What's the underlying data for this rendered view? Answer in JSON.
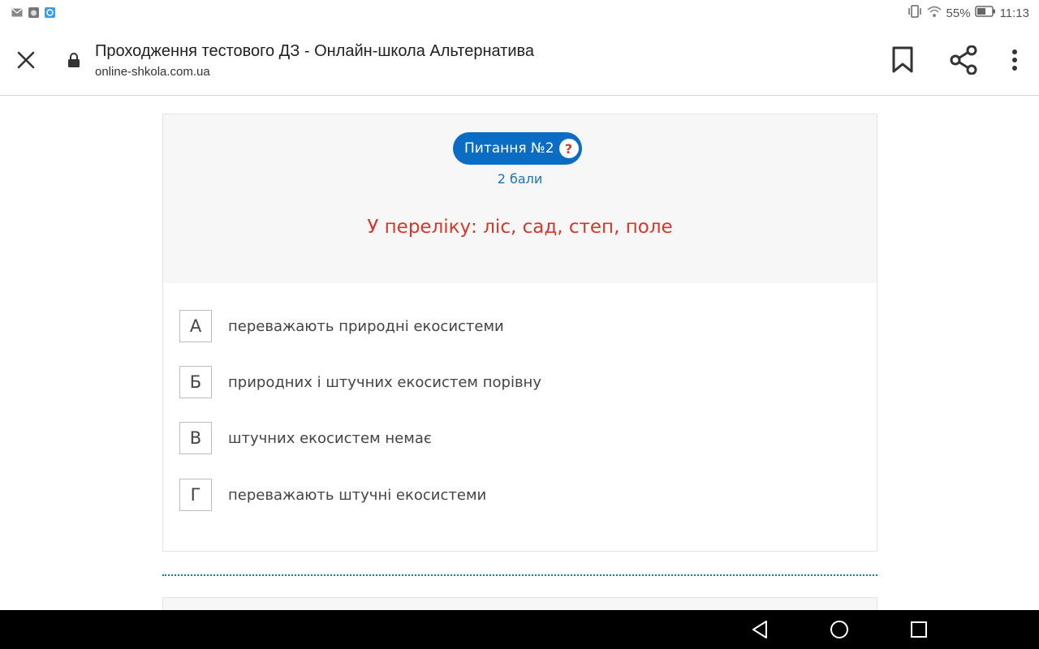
{
  "status_bar": {
    "left_icons": [
      "mail-icon",
      "cat-app-icon",
      "blue-app-icon"
    ],
    "battery_percent": "55%",
    "time": "11:13",
    "right_icons": [
      "vibrate-icon",
      "wifi-icon",
      "battery-icon"
    ]
  },
  "browser": {
    "page_title": "Проходження тестового ДЗ - Онлайн-школа Альтернатива",
    "url": "online-shkola.com.ua",
    "icons": [
      "close-icon",
      "lock-icon",
      "bookmark-icon",
      "share-icon",
      "more-vert-icon"
    ]
  },
  "question": {
    "label": "Питання №2",
    "help_symbol": "?",
    "points": "2 бали",
    "text": "У переліку: ліс, сад, степ, поле",
    "options": [
      {
        "letter": "А",
        "text": "переважають природні екосистеми"
      },
      {
        "letter": "Б",
        "text": "природних і штучних екосистем порівну"
      },
      {
        "letter": "В",
        "text": "штучних екосистем немає"
      },
      {
        "letter": "Г",
        "text": "переважають штучні екосистеми"
      }
    ]
  },
  "colors": {
    "pill_blue": "#0b6cc4",
    "points_blue": "#1a72b8",
    "question_red": "#d2392b",
    "header_bg": "#f7f7f7"
  },
  "nav_bar": {
    "icons": [
      "back-triangle-icon",
      "home-circle-icon",
      "recents-square-icon"
    ]
  }
}
